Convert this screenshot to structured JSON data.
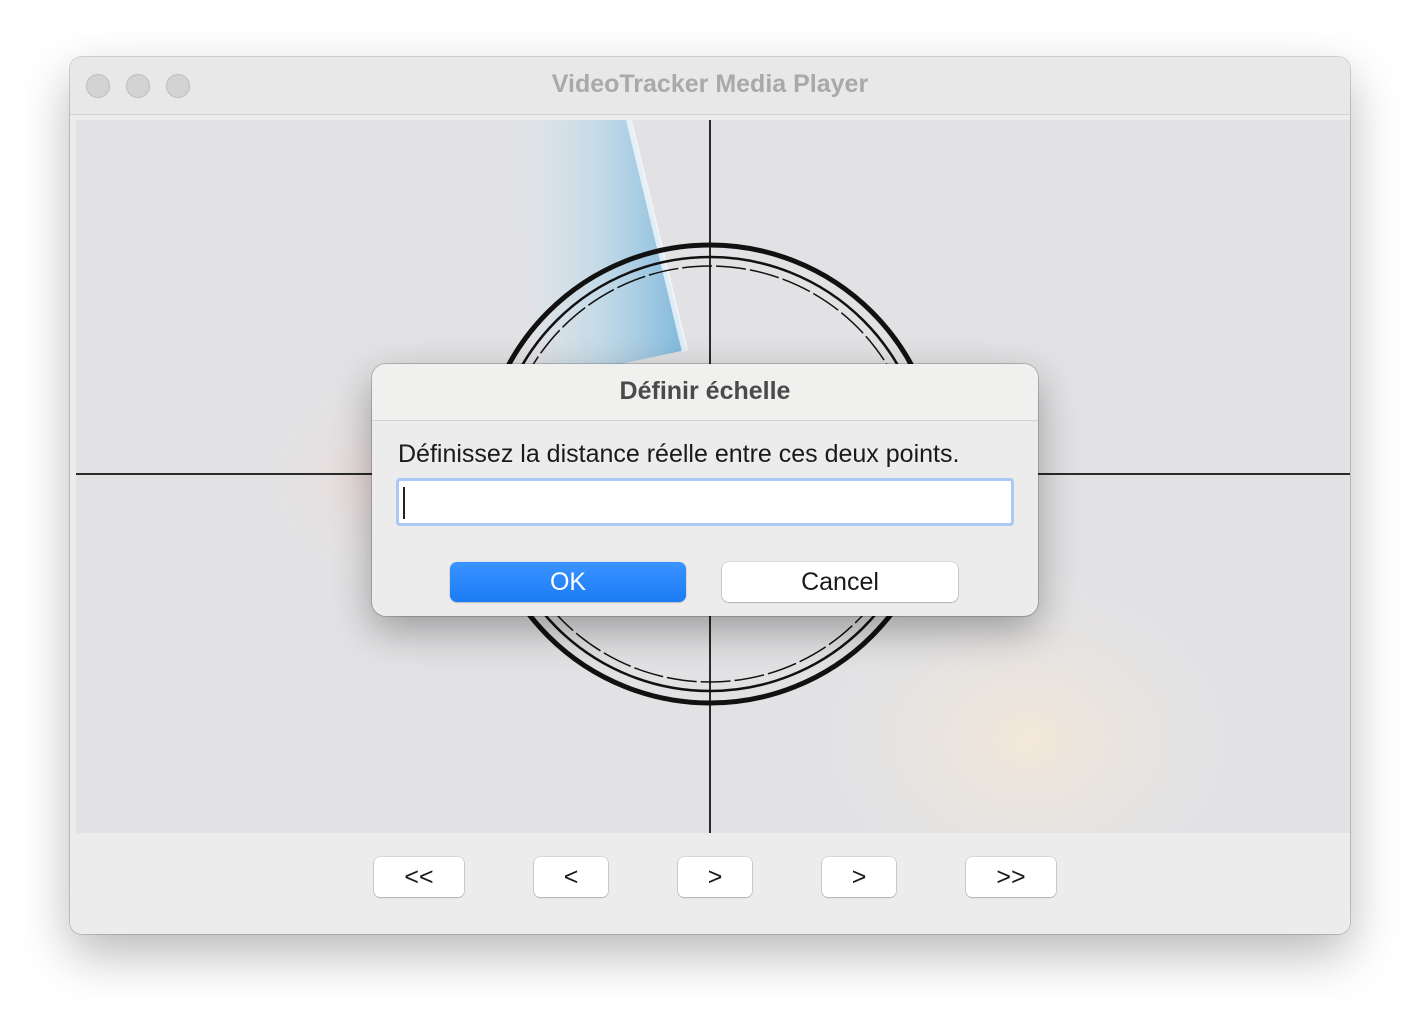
{
  "window": {
    "title": "VideoTracker Media Player"
  },
  "controls": {
    "first_label": "<<",
    "prev_label": "<",
    "play_label": ">",
    "next_label": ">",
    "last_label": ">>"
  },
  "dialog": {
    "title": "Définir échelle",
    "message": "Définissez la distance réelle entre ces deux points.",
    "input_value": "",
    "ok_label": "OK",
    "cancel_label": "Cancel"
  },
  "colors": {
    "accent": "#1a7cf5",
    "window_bg": "#ececec"
  }
}
